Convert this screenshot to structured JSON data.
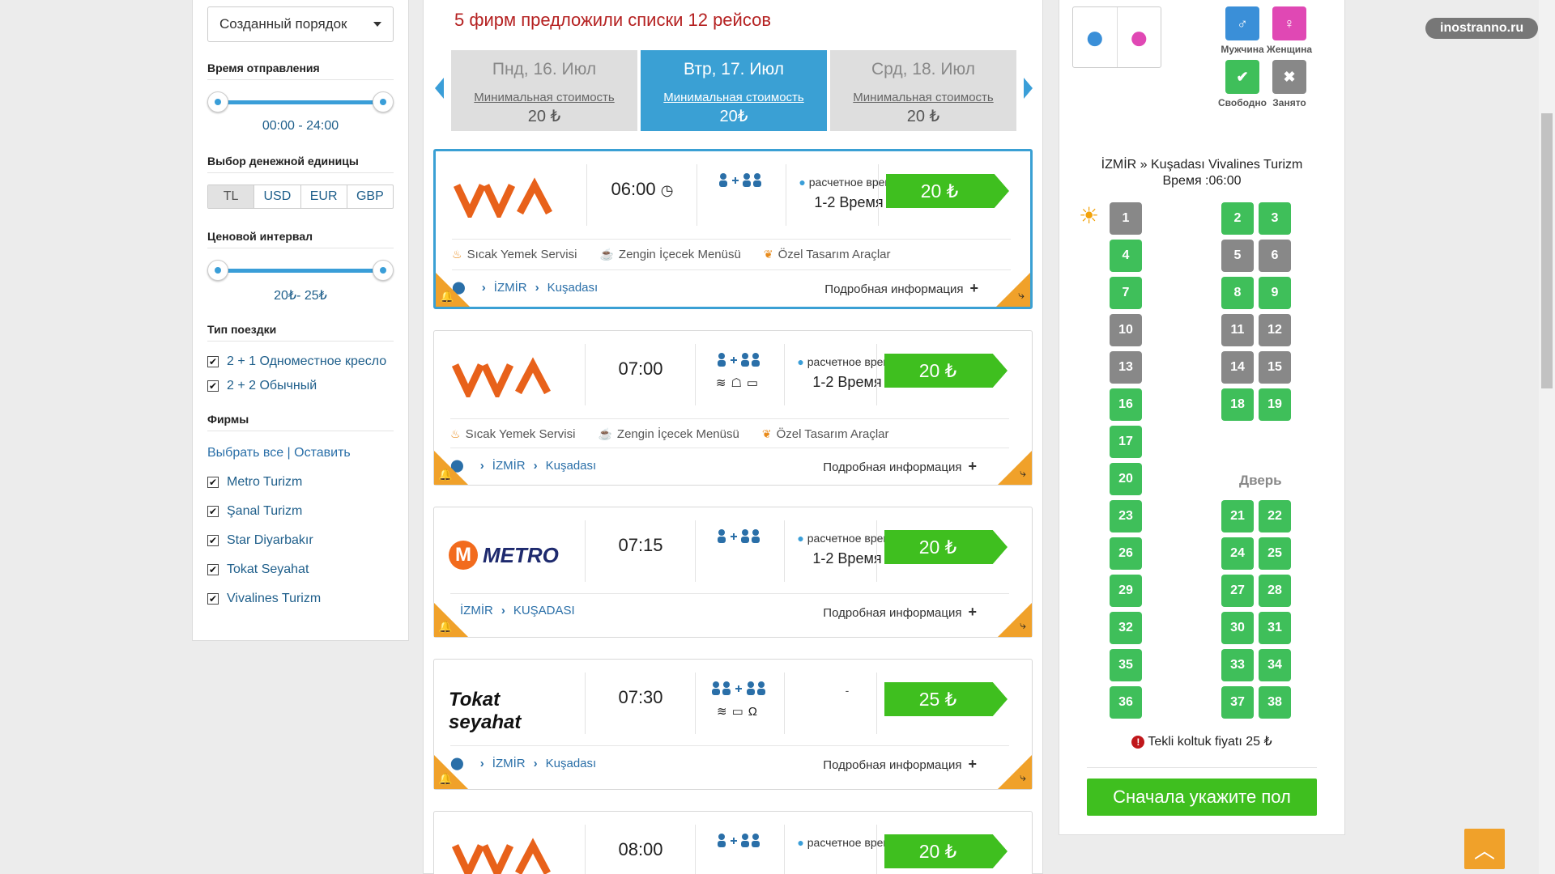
{
  "sidebar": {
    "sort_value": "Созданный порядок",
    "departure": {
      "title": "Время отправления",
      "range": "00:00 - 24:00"
    },
    "currency": {
      "title": "Выбор денежной единицы",
      "options": [
        "TL",
        "USD",
        "EUR",
        "GBP"
      ],
      "selected": "TL"
    },
    "price": {
      "title": "Ценовой интервал",
      "range": "20₺- 25₺"
    },
    "trip_type": {
      "title": "Тип поездки",
      "items": [
        "2 + 1 Одноместное кресло",
        "2 + 2 Обычный"
      ]
    },
    "firms": {
      "title": "Фирмы",
      "links": "Выбрать все | Оставить",
      "items": [
        "Metro Turizm",
        "Şanal Turizm",
        "Star Diyarbakır",
        "Tokat Seyahat",
        "Vivalines Turizm"
      ]
    }
  },
  "main": {
    "headline": "5 фирм предложили списки 12 рейсов",
    "dates": [
      {
        "name": "Пнд, 16. Июл",
        "label": "Минимальная стоимость",
        "price": "20 ₺"
      },
      {
        "name": "Втр, 17. Июл",
        "label": "Минимальная стоимость",
        "price": "20₺"
      },
      {
        "name": "Срд, 18. Июл",
        "label": "Минимальная стоимость",
        "price": "20 ₺"
      }
    ],
    "details_label": "Подробная информация",
    "trips": [
      {
        "logo": "VIVA",
        "time": "06:00",
        "seats": "2+1",
        "est": "расчетное время",
        "duration": "1-2 Время",
        "price": "20 ₺",
        "amenities": [
          "Sıcak Yemek Servisi",
          "Zengin İçecek Menüsü",
          "Özel Tasarım Araçlar"
        ],
        "from": "İZMİR",
        "to": "Kuşadası"
      },
      {
        "logo": "VIVA",
        "time": "07:00",
        "seats": "2+1",
        "est": "расчетное время",
        "duration": "1-2 Время",
        "price": "20 ₺",
        "amenities": [
          "Sıcak Yemek Servisi",
          "Zengin İçecek Menüsü",
          "Özel Tasarım Araçlar"
        ],
        "from": "İZMİR",
        "to": "Kuşadası"
      },
      {
        "logo": "METRO",
        "time": "07:15",
        "seats": "2+1",
        "est": "расчетное время",
        "duration": "1-2 Время",
        "price": "20 ₺",
        "from": "İZMİR",
        "to": "KUŞADASI"
      },
      {
        "logo": "Tokat seyahat",
        "time": "07:30",
        "seats": "2+2",
        "est": "-",
        "price": "25 ₺",
        "from": "İZMİR",
        "to": "Kuşadası"
      },
      {
        "logo": "VIVA",
        "time": "08:00",
        "seats": "2+1",
        "est": "расчетное время",
        "price": "20 ₺"
      }
    ]
  },
  "seat_panel": {
    "legend": {
      "male": "Мужчина",
      "female": "Женщина",
      "free": "Свободно",
      "taken": "Занято"
    },
    "route": "İZMİR » Kuşadası Vivalines Turizm",
    "time": "Время :06:00",
    "door": "Дверь",
    "single_price": "Tekli koltuk fiyatı 25 ₺",
    "cta": "Сначала укажите пол",
    "seats": [
      {
        "n": "1",
        "s": "taken"
      },
      {
        "n": "2",
        "s": "free"
      },
      {
        "n": "3",
        "s": "free"
      },
      {
        "n": "4",
        "s": "free"
      },
      {
        "n": "5",
        "s": "taken"
      },
      {
        "n": "6",
        "s": "taken"
      },
      {
        "n": "7",
        "s": "free"
      },
      {
        "n": "8",
        "s": "free"
      },
      {
        "n": "9",
        "s": "free"
      },
      {
        "n": "10",
        "s": "taken"
      },
      {
        "n": "11",
        "s": "taken"
      },
      {
        "n": "12",
        "s": "taken"
      },
      {
        "n": "13",
        "s": "taken"
      },
      {
        "n": "14",
        "s": "taken"
      },
      {
        "n": "15",
        "s": "taken"
      },
      {
        "n": "16",
        "s": "free"
      },
      {
        "n": "18",
        "s": "free"
      },
      {
        "n": "19",
        "s": "free"
      },
      {
        "n": "17",
        "s": "free"
      },
      {
        "n": "20",
        "s": "free"
      },
      {
        "n": "23",
        "s": "free"
      },
      {
        "n": "21",
        "s": "free"
      },
      {
        "n": "22",
        "s": "free"
      },
      {
        "n": "26",
        "s": "free"
      },
      {
        "n": "24",
        "s": "free"
      },
      {
        "n": "25",
        "s": "free"
      },
      {
        "n": "29",
        "s": "free"
      },
      {
        "n": "27",
        "s": "free"
      },
      {
        "n": "28",
        "s": "free"
      },
      {
        "n": "32",
        "s": "free"
      },
      {
        "n": "30",
        "s": "free"
      },
      {
        "n": "31",
        "s": "free"
      },
      {
        "n": "35",
        "s": "free"
      },
      {
        "n": "33",
        "s": "free"
      },
      {
        "n": "34",
        "s": "free"
      },
      {
        "n": "36",
        "s": "free"
      },
      {
        "n": "37",
        "s": "free"
      },
      {
        "n": "38",
        "s": "free"
      }
    ]
  },
  "watermark": "inostranno.ru",
  "colors": {
    "accent": "#3aa0d4",
    "price": "#3fbf1f",
    "headline": "#b52121",
    "corner": "#f0a12a",
    "taken": "#888888"
  }
}
